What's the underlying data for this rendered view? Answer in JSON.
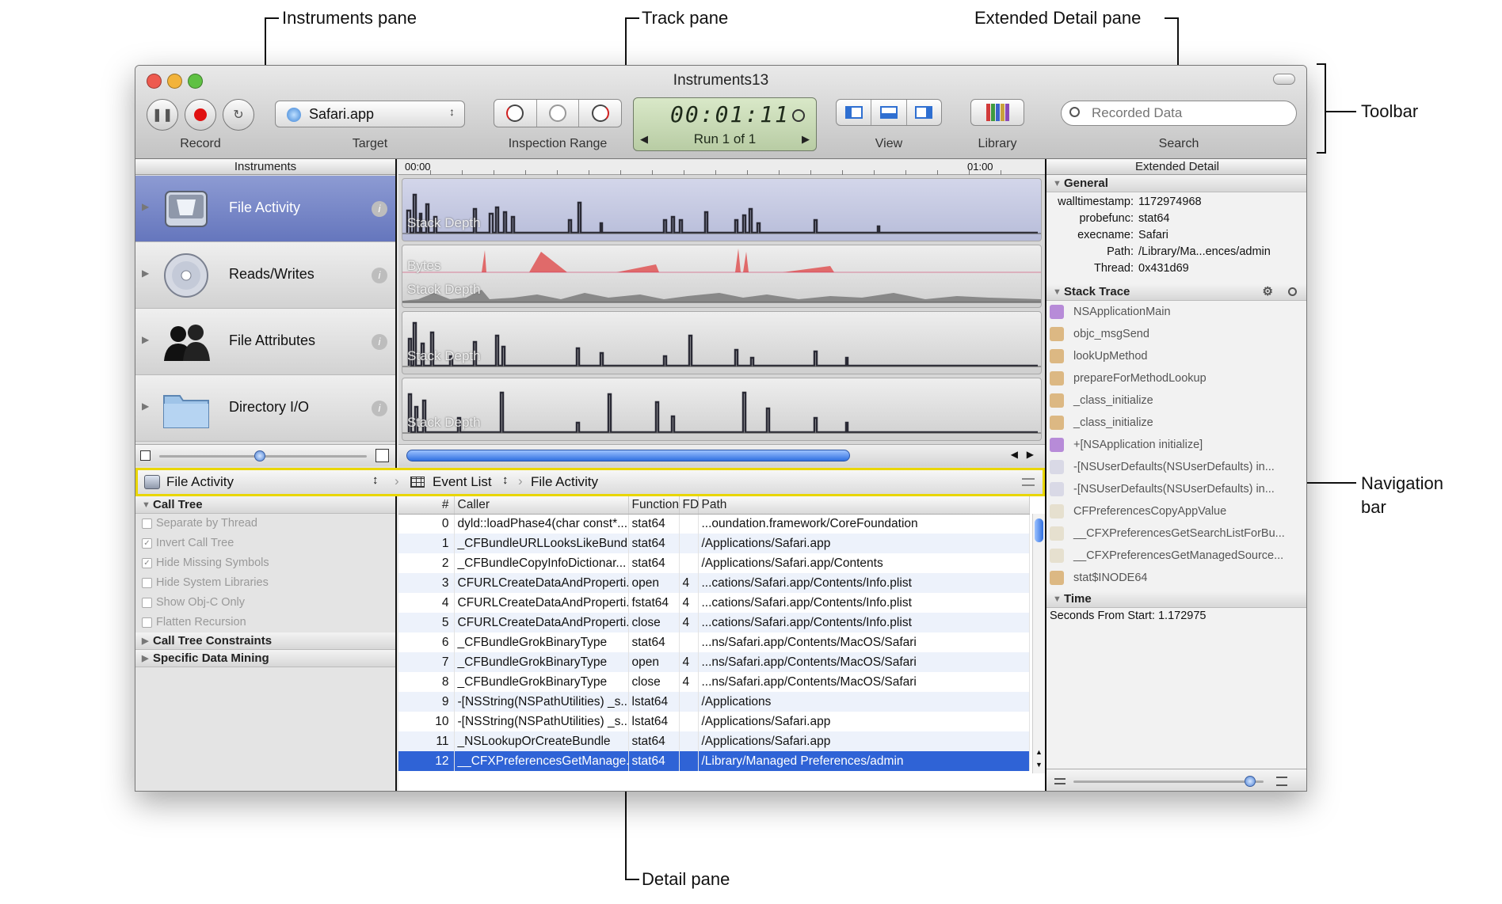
{
  "callouts": {
    "instruments_pane": "Instruments pane",
    "track_pane": "Track pane",
    "extended_detail_pane": "Extended Detail pane",
    "toolbar": "Toolbar",
    "navigation_bar_line1": "Navigation",
    "navigation_bar_line2": "bar",
    "detail_pane": "Detail pane"
  },
  "window": {
    "title": "Instruments13"
  },
  "toolbar": {
    "record_label": "Record",
    "target_value": "Safari.app",
    "target_label": "Target",
    "inspection_label": "Inspection Range",
    "time": "00:01:11",
    "run": "Run 1 of 1",
    "view_label": "View",
    "library_label": "Library",
    "search_placeholder": "Recorded Data",
    "search_label": "Search"
  },
  "instruments": {
    "header": "Instruments",
    "items": [
      {
        "name": "File Activity",
        "icon": "disk-icon"
      },
      {
        "name": "Reads/Writes",
        "icon": "cd-icon"
      },
      {
        "name": "File Attributes",
        "icon": "people-icon"
      },
      {
        "name": "Directory I/O",
        "icon": "folder-icon"
      }
    ]
  },
  "track": {
    "time_start": "00:00",
    "time_end": "01:00",
    "labels": {
      "stack_depth": "Stack Depth",
      "bytes": "Bytes"
    }
  },
  "nav": {
    "instrument": "File Activity",
    "view": "Event List",
    "crumb": "File Activity"
  },
  "options": {
    "call_tree": "Call Tree",
    "items": [
      {
        "label": "Separate by Thread",
        "checked": false
      },
      {
        "label": "Invert Call Tree",
        "checked": true
      },
      {
        "label": "Hide Missing Symbols",
        "checked": true
      },
      {
        "label": "Hide System Libraries",
        "checked": false
      },
      {
        "label": "Show Obj-C Only",
        "checked": false
      },
      {
        "label": "Flatten Recursion",
        "checked": false
      }
    ],
    "constraints": "Call Tree Constraints",
    "mining": "Specific Data Mining"
  },
  "table": {
    "columns": [
      "#",
      "Caller",
      "Function",
      "FD",
      "Path"
    ],
    "rows": [
      [
        "0",
        "dyld::loadPhase4(char const*...",
        "stat64",
        "",
        "...oundation.framework/CoreFoundation"
      ],
      [
        "1",
        "_CFBundleURLLooksLikeBund...",
        "stat64",
        "",
        "/Applications/Safari.app"
      ],
      [
        "2",
        "_CFBundleCopyInfoDictionar...",
        "stat64",
        "",
        "/Applications/Safari.app/Contents"
      ],
      [
        "3",
        "CFURLCreateDataAndProperti...",
        "open",
        "4",
        "...cations/Safari.app/Contents/Info.plist"
      ],
      [
        "4",
        "CFURLCreateDataAndProperti...",
        "fstat64",
        "4",
        "...cations/Safari.app/Contents/Info.plist"
      ],
      [
        "5",
        "CFURLCreateDataAndProperti...",
        "close",
        "4",
        "...cations/Safari.app/Contents/Info.plist"
      ],
      [
        "6",
        "_CFBundleGrokBinaryType",
        "stat64",
        "",
        "...ns/Safari.app/Contents/MacOS/Safari"
      ],
      [
        "7",
        "_CFBundleGrokBinaryType",
        "open",
        "4",
        "...ns/Safari.app/Contents/MacOS/Safari"
      ],
      [
        "8",
        "_CFBundleGrokBinaryType",
        "close",
        "4",
        "...ns/Safari.app/Contents/MacOS/Safari"
      ],
      [
        "9",
        "-[NSString(NSPathUtilities) _s...",
        "lstat64",
        "",
        "/Applications"
      ],
      [
        "10",
        "-[NSString(NSPathUtilities) _s...",
        "lstat64",
        "",
        "/Applications/Safari.app"
      ],
      [
        "11",
        "_NSLookupOrCreateBundle",
        "stat64",
        "",
        "/Applications/Safari.app"
      ],
      [
        "12",
        "__CFXPreferencesGetManage...",
        "stat64",
        "",
        "/Library/Managed Preferences/admin"
      ]
    ],
    "selected_row": 12
  },
  "extended": {
    "header": "Extended Detail",
    "general_title": "General",
    "general": [
      {
        "k": "walltimestamp:",
        "v": "1172974968"
      },
      {
        "k": "probefunc:",
        "v": "stat64"
      },
      {
        "k": "execname:",
        "v": "Safari"
      },
      {
        "k": "Path:",
        "v": "/Library/Ma...ences/admin"
      },
      {
        "k": "Thread:",
        "v": "0x431d69"
      }
    ],
    "stack_title": "Stack Trace",
    "stack": [
      "NSApplicationMain",
      "objc_msgSend",
      "lookUpMethod",
      "prepareForMethodLookup",
      "_class_initialize",
      "_class_initialize",
      "+[NSApplication initialize]",
      "-[NSUserDefaults(NSUserDefaults) in...",
      "-[NSUserDefaults(NSUserDefaults) in...",
      "CFPreferencesCopyAppValue",
      "__CFXPreferencesGetSearchListForBu...",
      "__CFXPreferencesGetManagedSource...",
      "stat$INODE64"
    ],
    "time_title": "Time",
    "time_line": "Seconds From Start: 1.172975"
  }
}
